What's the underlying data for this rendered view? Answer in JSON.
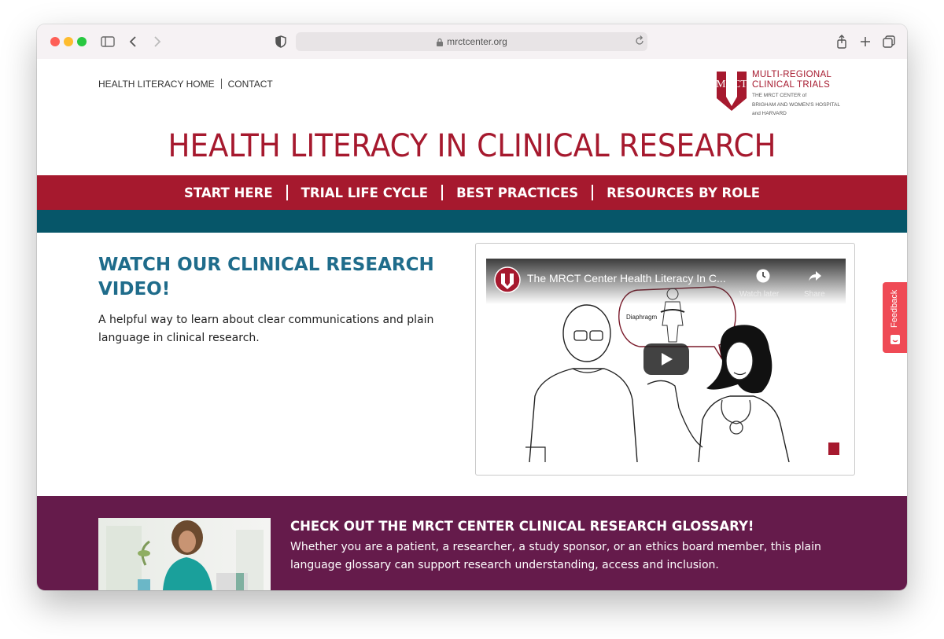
{
  "browser": {
    "url": "mrctcenter.org"
  },
  "top_links": {
    "home": "HEALTH LITERACY HOME",
    "contact": "CONTACT"
  },
  "logo": {
    "mark": "MRCT",
    "line1": "MULTI-REGIONAL",
    "line2": "CLINICAL TRIALS",
    "sub1": "THE MRCT CENTER of",
    "sub2": "BRIGHAM AND WOMEN'S HOSPITAL",
    "sub3": "and HARVARD"
  },
  "site_title": "HEALTH LITERACY IN CLINICAL RESEARCH",
  "nav": {
    "items": [
      {
        "label": "START HERE"
      },
      {
        "label": "TRIAL LIFE CYCLE"
      },
      {
        "label": "BEST PRACTICES"
      },
      {
        "label": "RESOURCES BY ROLE"
      }
    ]
  },
  "video_section": {
    "heading": "WATCH OUR CLINICAL RESEARCH VIDEO!",
    "description": "A helpful way to learn about clear communications and plain language in clinical research.",
    "video_title": "The MRCT Center Health Literacy In C...",
    "watch_later": "Watch later",
    "share": "Share",
    "diagram_label": "Diaphragm"
  },
  "feedback": {
    "label": "Feedback"
  },
  "glossary": {
    "heading": "CHECK OUT THE MRCT CENTER CLINICAL RESEARCH GLOSSARY!",
    "body": "Whether you are a patient, a researcher, a study sponsor, or an ethics board member, this plain language glossary can support research understanding, access and inclusion."
  },
  "colors": {
    "brand_red": "#a6192e",
    "teal": "#065669",
    "heading_blue": "#1f6c8b",
    "plum": "#651b4b",
    "feedback_red": "#ef4a55"
  }
}
